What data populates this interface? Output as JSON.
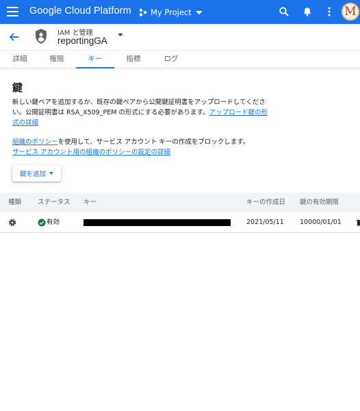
{
  "topbar": {
    "app_title": "Google Cloud Platform",
    "project_name": "My Project",
    "avatar_letter": "M",
    "brand_color": "#1a73e8"
  },
  "subheader": {
    "service_label": "IAM と管理",
    "account_name": "reportingGA"
  },
  "tabs": [
    {
      "label": "詳細",
      "active": false
    },
    {
      "label": "権限",
      "active": false
    },
    {
      "label": "キー",
      "active": true
    },
    {
      "label": "指標",
      "active": false
    },
    {
      "label": "ログ",
      "active": false
    }
  ],
  "main": {
    "section_title": "鍵",
    "desc_line1": "新しい鍵ペアを追加するか、既存の鍵ペアから公開鍵証明書をアップロードしてくださ",
    "desc_line2_prefix": "い。公開証明書は RSA_X509_PEM の形式にする必要があります。",
    "desc_link_part1": "アップロード鍵の形",
    "desc_link_part2": "式の詳細",
    "policy_link": "組織のポリシー",
    "policy_text": "を使用して、サービス アカウント キーの作成をブロックします。",
    "policy_settings_link": "サービス アカウント用の組織のポリシーの設定の詳細",
    "add_key_label": "鍵を追加"
  },
  "table": {
    "columns": [
      "種類",
      "ステータス",
      "キー",
      "キーの作成日",
      "鍵の有効期限"
    ],
    "rows": [
      {
        "type_icon": "gear-icon",
        "status": "有効",
        "key_redacted": true,
        "created": "2021/05/11",
        "expires": "10000/01/01"
      }
    ]
  },
  "colors": {
    "link": "#1a73e8",
    "status_ok": "#188038",
    "table_header_bg": "#f1f3f4"
  }
}
